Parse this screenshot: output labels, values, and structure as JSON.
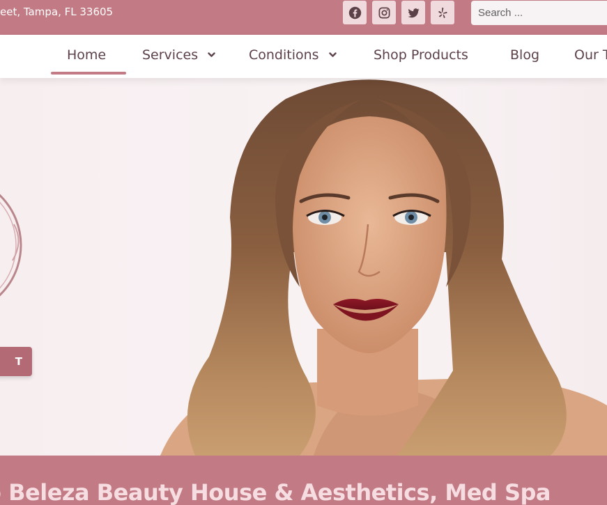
{
  "topbar": {
    "address": "eet, Tampa, FL 33605",
    "social": [
      {
        "name": "facebook-icon"
      },
      {
        "name": "instagram-icon"
      },
      {
        "name": "twitter-icon"
      },
      {
        "name": "yelp-icon"
      }
    ],
    "search_placeholder": "Search ..."
  },
  "nav": {
    "items": [
      {
        "label": "Home",
        "active": true
      },
      {
        "label": "Services",
        "dropdown": true
      },
      {
        "label": "Conditions",
        "dropdown": true
      },
      {
        "label": "Shop Products"
      },
      {
        "label": "Blog"
      },
      {
        "label": "Our T"
      }
    ]
  },
  "hero": {
    "cta_label": "T",
    "image": "portrait-woman-wavy-hair"
  },
  "banner": {
    "title": "o Beleza Beauty House & Aesthetics, Med Spa"
  },
  "colors": {
    "brand": "#c27a84",
    "nav_text": "#5c4148",
    "button": "#b36a74"
  }
}
